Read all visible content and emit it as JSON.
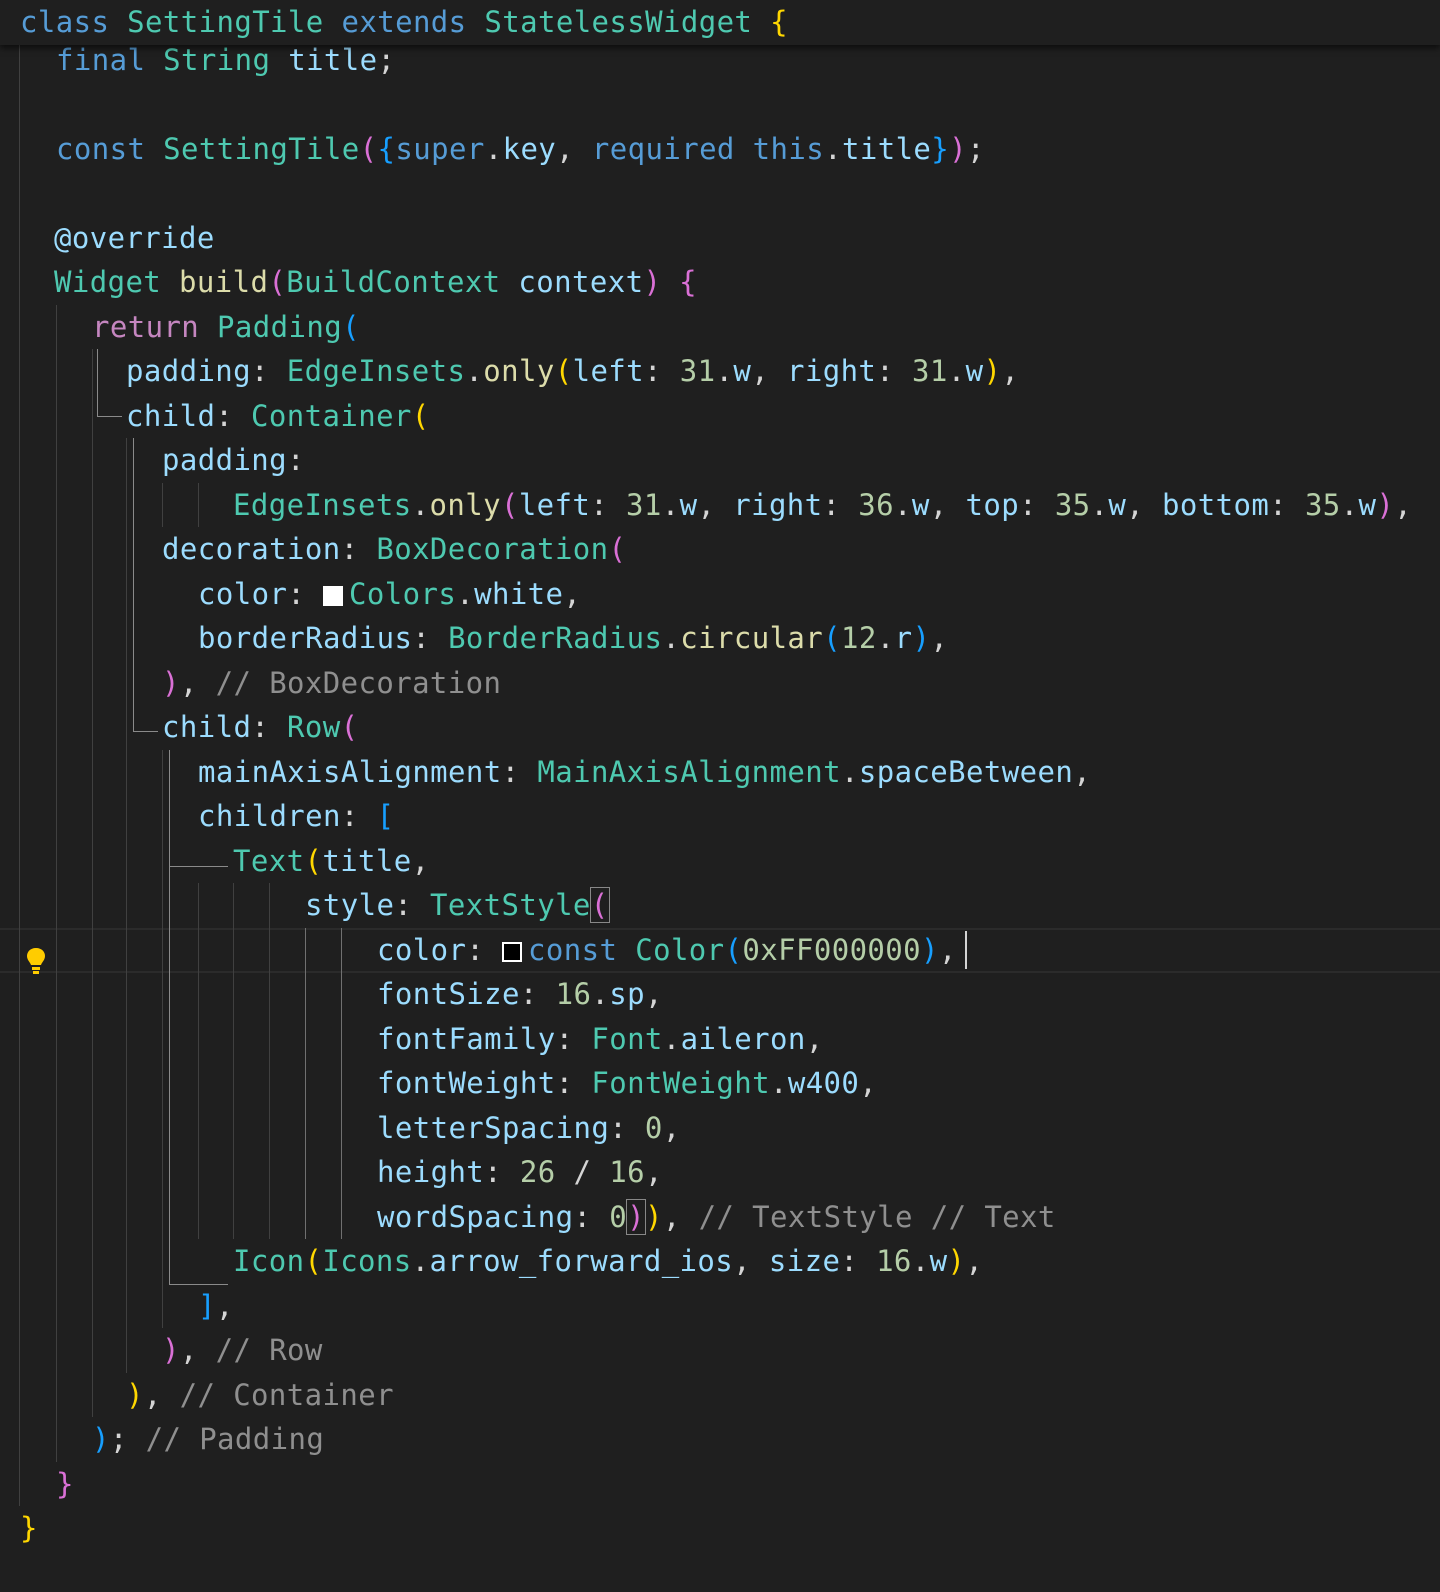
{
  "editor": {
    "theme_colors": {
      "background": "#1f1f1f",
      "keyword": "#569cd6",
      "control": "#c586c0",
      "class": "#4ec9b0",
      "variable": "#9cdcfe",
      "function": "#dcdcaa",
      "number": "#b5cea8",
      "comment": "#8f8f8f"
    },
    "lines": [
      {
        "tokens": [
          [
            "class ",
            "kw"
          ],
          [
            "SettingTile ",
            "cls"
          ],
          [
            "extends ",
            "kw"
          ],
          [
            "StatelessWidget ",
            "cls"
          ],
          [
            "{",
            "b1"
          ]
        ]
      },
      {
        "tokens": [
          [
            "final ",
            "kw"
          ],
          [
            "String ",
            "cls"
          ],
          [
            "title",
            "var"
          ],
          [
            ";",
            "p"
          ]
        ]
      },
      {
        "tokens": []
      },
      {
        "tokens": [
          [
            "const ",
            "kw"
          ],
          [
            "SettingTile",
            "cls"
          ],
          [
            "(",
            "b2"
          ],
          [
            "{",
            "b3"
          ],
          [
            "super",
            "kw"
          ],
          [
            ".",
            "p"
          ],
          [
            "key",
            "var"
          ],
          [
            ", ",
            "p"
          ],
          [
            "required ",
            "kw"
          ],
          [
            "this",
            "kw"
          ],
          [
            ".",
            "p"
          ],
          [
            "title",
            "var"
          ],
          [
            "}",
            "b3"
          ],
          [
            ")",
            "b2"
          ],
          [
            ";",
            "p"
          ]
        ]
      },
      {
        "tokens": []
      },
      {
        "tokens": [
          [
            "@override",
            "var"
          ]
        ]
      },
      {
        "tokens": [
          [
            "Widget ",
            "cls"
          ],
          [
            "build",
            "fn"
          ],
          [
            "(",
            "b2"
          ],
          [
            "BuildContext ",
            "cls"
          ],
          [
            "context",
            "var"
          ],
          [
            ") ",
            "b2"
          ],
          [
            "{",
            "b2"
          ]
        ]
      },
      {
        "tokens": [
          [
            "return ",
            "ctrl"
          ],
          [
            "Padding",
            "cls"
          ],
          [
            "(",
            "b3"
          ]
        ]
      },
      {
        "tokens": [
          [
            "padding",
            "var"
          ],
          [
            ": ",
            "p"
          ],
          [
            "EdgeInsets",
            "cls"
          ],
          [
            ".",
            "p"
          ],
          [
            "only",
            "fn"
          ],
          [
            "(",
            "b1"
          ],
          [
            "left",
            "var"
          ],
          [
            ": ",
            "p"
          ],
          [
            "31",
            "num"
          ],
          [
            ".",
            "p"
          ],
          [
            "w",
            "var"
          ],
          [
            ", ",
            "p"
          ],
          [
            "right",
            "var"
          ],
          [
            ": ",
            "p"
          ],
          [
            "31",
            "num"
          ],
          [
            ".",
            "p"
          ],
          [
            "w",
            "var"
          ],
          [
            ")",
            "b1"
          ],
          [
            ",",
            "p"
          ]
        ]
      },
      {
        "tokens": [
          [
            "child",
            "var"
          ],
          [
            ": ",
            "p"
          ],
          [
            "Container",
            "cls"
          ],
          [
            "(",
            "b1"
          ]
        ]
      },
      {
        "tokens": [
          [
            "padding",
            "var"
          ],
          [
            ":",
            "p"
          ]
        ]
      },
      {
        "tokens": [
          [
            "EdgeInsets",
            "cls"
          ],
          [
            ".",
            "p"
          ],
          [
            "only",
            "fn"
          ],
          [
            "(",
            "b2"
          ],
          [
            "left",
            "var"
          ],
          [
            ": ",
            "p"
          ],
          [
            "31",
            "num"
          ],
          [
            ".",
            "p"
          ],
          [
            "w",
            "var"
          ],
          [
            ", ",
            "p"
          ],
          [
            "right",
            "var"
          ],
          [
            ": ",
            "p"
          ],
          [
            "36",
            "num"
          ],
          [
            ".",
            "p"
          ],
          [
            "w",
            "var"
          ],
          [
            ", ",
            "p"
          ],
          [
            "top",
            "var"
          ],
          [
            ": ",
            "p"
          ],
          [
            "35",
            "num"
          ],
          [
            ".",
            "p"
          ],
          [
            "w",
            "var"
          ],
          [
            ", ",
            "p"
          ],
          [
            "bottom",
            "var"
          ],
          [
            ": ",
            "p"
          ],
          [
            "35",
            "num"
          ],
          [
            ".",
            "p"
          ],
          [
            "w",
            "var"
          ],
          [
            ")",
            "b2"
          ],
          [
            ",",
            "p"
          ]
        ]
      },
      {
        "tokens": [
          [
            "decoration",
            "var"
          ],
          [
            ": ",
            "p"
          ],
          [
            "BoxDecoration",
            "cls"
          ],
          [
            "(",
            "b2"
          ]
        ]
      },
      {
        "tokens": [
          [
            "color",
            "var"
          ],
          [
            ": ",
            "p"
          ],
          [
            "",
            "swatch-white"
          ],
          [
            "Colors",
            "cls"
          ],
          [
            ".",
            "p"
          ],
          [
            "white",
            "var"
          ],
          [
            ",",
            "p"
          ]
        ]
      },
      {
        "tokens": [
          [
            "borderRadius",
            "var"
          ],
          [
            ": ",
            "p"
          ],
          [
            "BorderRadius",
            "cls"
          ],
          [
            ".",
            "p"
          ],
          [
            "circular",
            "fn"
          ],
          [
            "(",
            "b3"
          ],
          [
            "12",
            "num"
          ],
          [
            ".",
            "p"
          ],
          [
            "r",
            "var"
          ],
          [
            ")",
            "b3"
          ],
          [
            ",",
            "p"
          ]
        ]
      },
      {
        "tokens": [
          [
            ")",
            "b2"
          ],
          [
            ", ",
            "p"
          ],
          [
            "// BoxDecoration",
            "cm"
          ]
        ]
      },
      {
        "tokens": [
          [
            "child",
            "var"
          ],
          [
            ": ",
            "p"
          ],
          [
            "Row",
            "cls"
          ],
          [
            "(",
            "b2"
          ]
        ]
      },
      {
        "tokens": [
          [
            "mainAxisAlignment",
            "var"
          ],
          [
            ": ",
            "p"
          ],
          [
            "MainAxisAlignment",
            "cls"
          ],
          [
            ".",
            "p"
          ],
          [
            "spaceBetween",
            "var"
          ],
          [
            ",",
            "p"
          ]
        ]
      },
      {
        "tokens": [
          [
            "children",
            "var"
          ],
          [
            ": ",
            "p"
          ],
          [
            "[",
            "b3"
          ]
        ]
      },
      {
        "tokens": [
          [
            "Text",
            "cls"
          ],
          [
            "(",
            "b1"
          ],
          [
            "title",
            "var"
          ],
          [
            ",",
            "p"
          ]
        ]
      },
      {
        "tokens": [
          [
            "style",
            "var"
          ],
          [
            ": ",
            "p"
          ],
          [
            "TextStyle",
            "cls"
          ],
          [
            "(",
            "b2bm"
          ]
        ]
      },
      {
        "tokens": [
          [
            "color",
            "var"
          ],
          [
            ": ",
            "p"
          ],
          [
            "",
            "swatch-black"
          ],
          [
            "const ",
            "kw"
          ],
          [
            "Color",
            "cls"
          ],
          [
            "(",
            "b3"
          ],
          [
            "0xFF000000",
            "num"
          ],
          [
            ")",
            "b3"
          ],
          [
            ",",
            "p"
          ]
        ]
      },
      {
        "tokens": [
          [
            "fontSize",
            "var"
          ],
          [
            ": ",
            "p"
          ],
          [
            "16",
            "num"
          ],
          [
            ".",
            "p"
          ],
          [
            "sp",
            "var"
          ],
          [
            ",",
            "p"
          ]
        ]
      },
      {
        "tokens": [
          [
            "fontFamily",
            "var"
          ],
          [
            ": ",
            "p"
          ],
          [
            "Font",
            "cls"
          ],
          [
            ".",
            "p"
          ],
          [
            "aileron",
            "var"
          ],
          [
            ",",
            "p"
          ]
        ]
      },
      {
        "tokens": [
          [
            "fontWeight",
            "var"
          ],
          [
            ": ",
            "p"
          ],
          [
            "FontWeight",
            "cls"
          ],
          [
            ".",
            "p"
          ],
          [
            "w400",
            "var"
          ],
          [
            ",",
            "p"
          ]
        ]
      },
      {
        "tokens": [
          [
            "letterSpacing",
            "var"
          ],
          [
            ": ",
            "p"
          ],
          [
            "0",
            "num"
          ],
          [
            ",",
            "p"
          ]
        ]
      },
      {
        "tokens": [
          [
            "height",
            "var"
          ],
          [
            ": ",
            "p"
          ],
          [
            "26",
            "num"
          ],
          [
            " / ",
            "p"
          ],
          [
            "16",
            "num"
          ],
          [
            ",",
            "p"
          ]
        ]
      },
      {
        "tokens": [
          [
            "wordSpacing",
            "var"
          ],
          [
            ": ",
            "p"
          ],
          [
            "0",
            "num"
          ],
          [
            ")",
            "b2bm"
          ],
          [
            ")",
            "b1"
          ],
          [
            ", ",
            "p"
          ],
          [
            "// TextStyle // Text",
            "cm"
          ]
        ]
      },
      {
        "tokens": [
          [
            "Icon",
            "cls"
          ],
          [
            "(",
            "b1"
          ],
          [
            "Icons",
            "cls"
          ],
          [
            ".",
            "p"
          ],
          [
            "arrow_forward_ios",
            "var"
          ],
          [
            ", ",
            "p"
          ],
          [
            "size",
            "var"
          ],
          [
            ": ",
            "p"
          ],
          [
            "16",
            "num"
          ],
          [
            ".",
            "p"
          ],
          [
            "w",
            "var"
          ],
          [
            ")",
            "b1"
          ],
          [
            ",",
            "p"
          ]
        ]
      },
      {
        "tokens": [
          [
            "]",
            "b3"
          ],
          [
            ",",
            "p"
          ]
        ]
      },
      {
        "tokens": [
          [
            ")",
            "b2"
          ],
          [
            ", ",
            "p"
          ],
          [
            "// Row",
            "cm"
          ]
        ]
      },
      {
        "tokens": [
          [
            ")",
            "b1"
          ],
          [
            ", ",
            "p"
          ],
          [
            "// Container",
            "cm"
          ]
        ]
      },
      {
        "tokens": [
          [
            ")",
            "b3"
          ],
          [
            "; ",
            "p"
          ],
          [
            "// Padding",
            "cm"
          ]
        ]
      },
      {
        "tokens": [
          [
            "}",
            "b2"
          ]
        ]
      },
      {
        "tokens": [
          [
            "}",
            "b1"
          ]
        ]
      }
    ]
  }
}
